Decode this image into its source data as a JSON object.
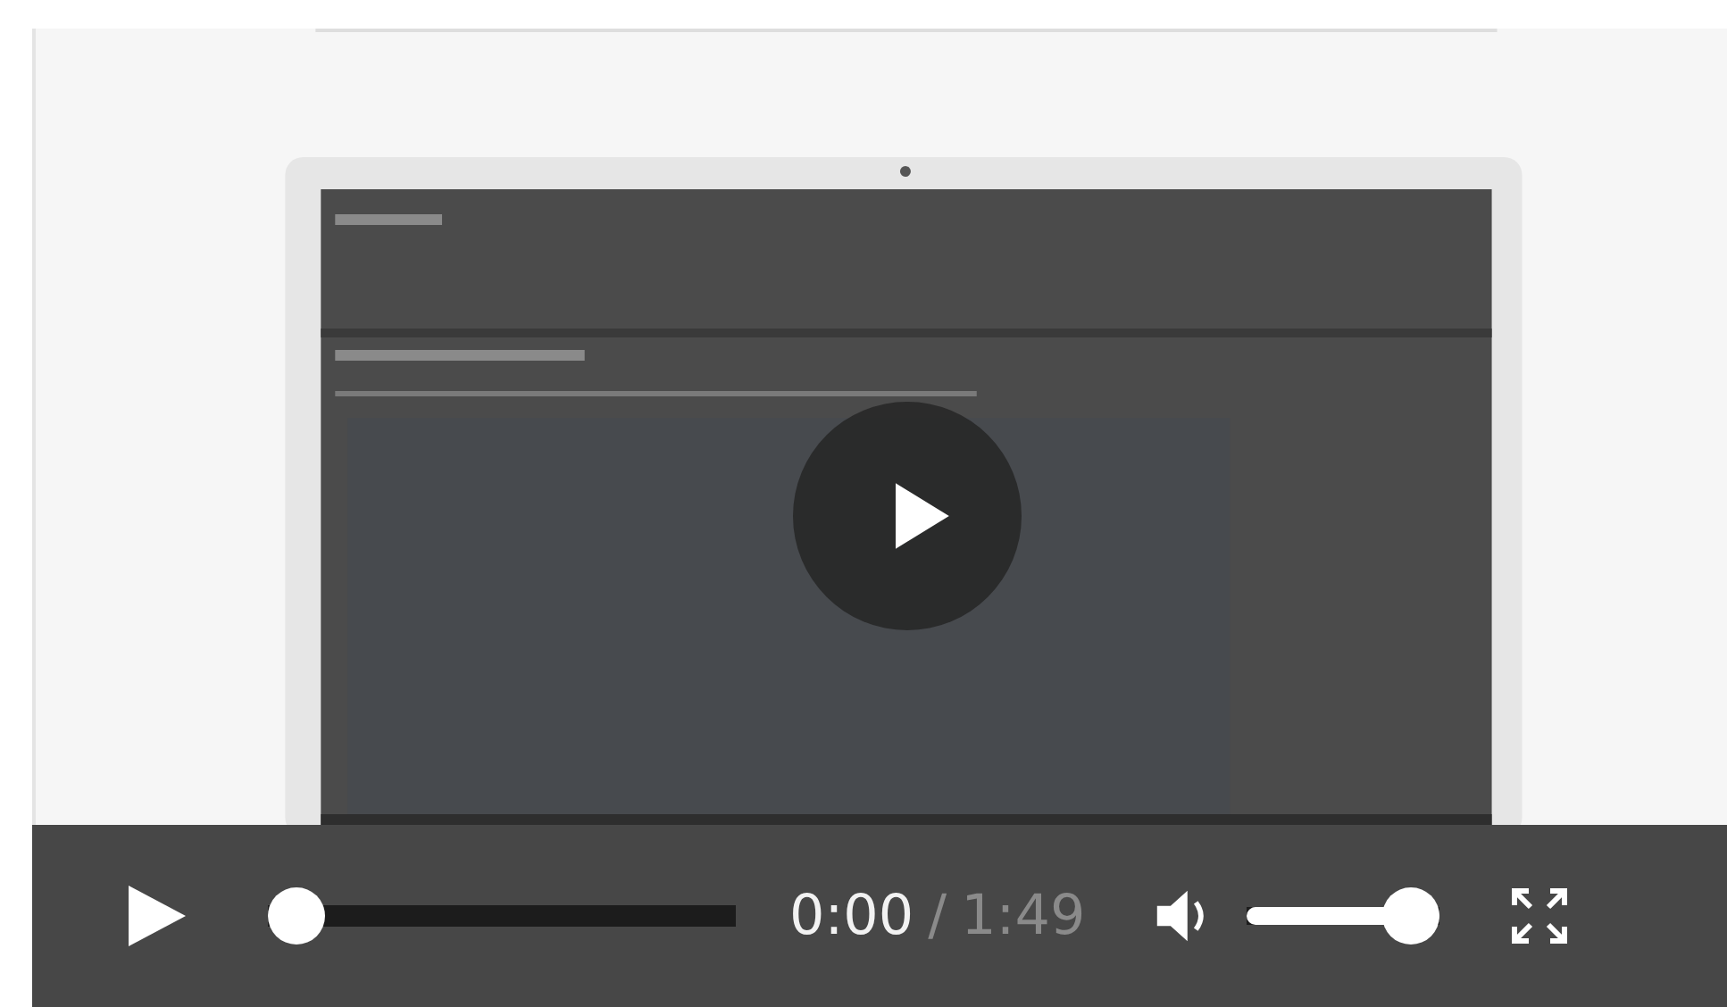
{
  "player": {
    "seek": {
      "level": 0
    },
    "time_current": "0:00",
    "time_separator": "/",
    "duration": "1:49",
    "volume": {
      "level": 1
    }
  }
}
